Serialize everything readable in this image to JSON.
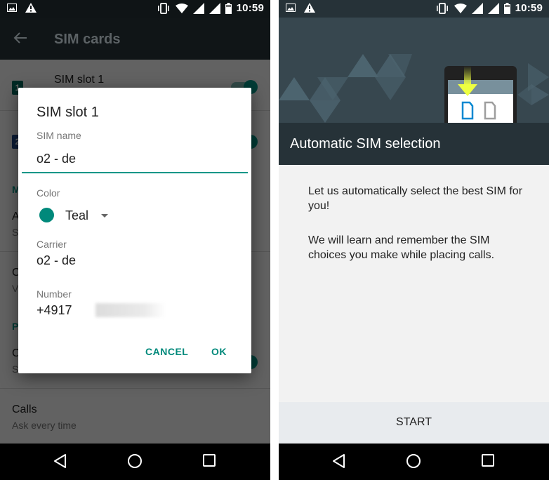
{
  "status_bar": {
    "time": "10:59",
    "left_icons": [
      "image-notification-icon",
      "warning-icon"
    ],
    "right_icons": [
      "vibrate-icon",
      "wifi-icon",
      "signal-icon",
      "signal-icon",
      "battery-icon"
    ]
  },
  "left_screen": {
    "app_bar": {
      "title": "SIM cards",
      "back_icon": "back-arrow-icon"
    },
    "list": {
      "sim1": {
        "badge": "1",
        "title": "SIM slot 1",
        "badge_color": "#00695c"
      },
      "sim2": {
        "badge": "2",
        "badge_color": "#1e4a8a"
      },
      "section_mobile": "M",
      "item_a": {
        "title": "A",
        "sub": "S"
      },
      "item_c": {
        "title": "C",
        "sub": "V"
      },
      "section_p": "P",
      "item_c2": {
        "title": "C",
        "sub": "S"
      },
      "calls": {
        "title": "Calls",
        "sub": "Ask every time"
      }
    },
    "dialog": {
      "title": "SIM slot 1",
      "sim_name_label": "SIM name",
      "sim_name_value": "o2 - de",
      "color_label": "Color",
      "color_value": "Teal",
      "color_hex": "#00897b",
      "carrier_label": "Carrier",
      "carrier_value": "o2 - de",
      "number_label": "Number",
      "number_value": "+4917",
      "cancel_label": "CANCEL",
      "ok_label": "OK"
    }
  },
  "right_screen": {
    "header_title": "Automatic SIM selection",
    "paragraph_1": "Let us automatically select the best SIM for you!",
    "paragraph_2": "We will learn and remember the SIM choices you make while placing calls.",
    "start_label": "START"
  },
  "nav_bar": {
    "icons": [
      "back-icon",
      "home-icon",
      "recents-icon"
    ]
  },
  "colors": {
    "accent": "#009688",
    "right_header": "#263238"
  }
}
